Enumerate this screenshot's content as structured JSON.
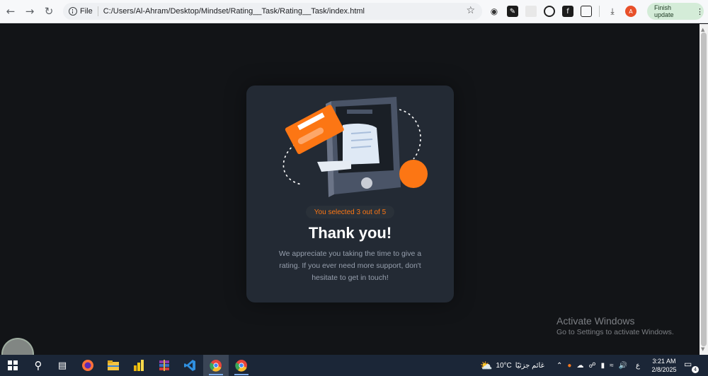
{
  "browser": {
    "scheme": "File",
    "url": "C:/Users/Al-Ahram/Desktop/Mindset/Rating__Task/Rating__Task/index.html",
    "finish_update": "Finish update",
    "avatar_letter": "A",
    "icons": [
      "back-icon",
      "forward-icon",
      "reload-icon",
      "info-icon",
      "star-icon",
      "download-icon",
      "kebab-menu-icon"
    ]
  },
  "card": {
    "selected_text": "You selected 3 out of 5",
    "title": "Thank you!",
    "message": "We appreciate you taking the time to give a rating. If you ever need more support, don't hesitate to get in touch!",
    "colors": {
      "accent": "#fc7614",
      "card_bg": "#232a34",
      "page_bg": "#121417"
    }
  },
  "windows_activation": {
    "line1": "Activate Windows",
    "line2": "Go to Settings to activate Windows."
  },
  "taskbar": {
    "weather_temp": "10°C",
    "weather_desc": "غائم جزئيًا",
    "input_lang": "ع",
    "time": "3:21 AM",
    "date": "2/8/2025",
    "notification_count": "4"
  }
}
